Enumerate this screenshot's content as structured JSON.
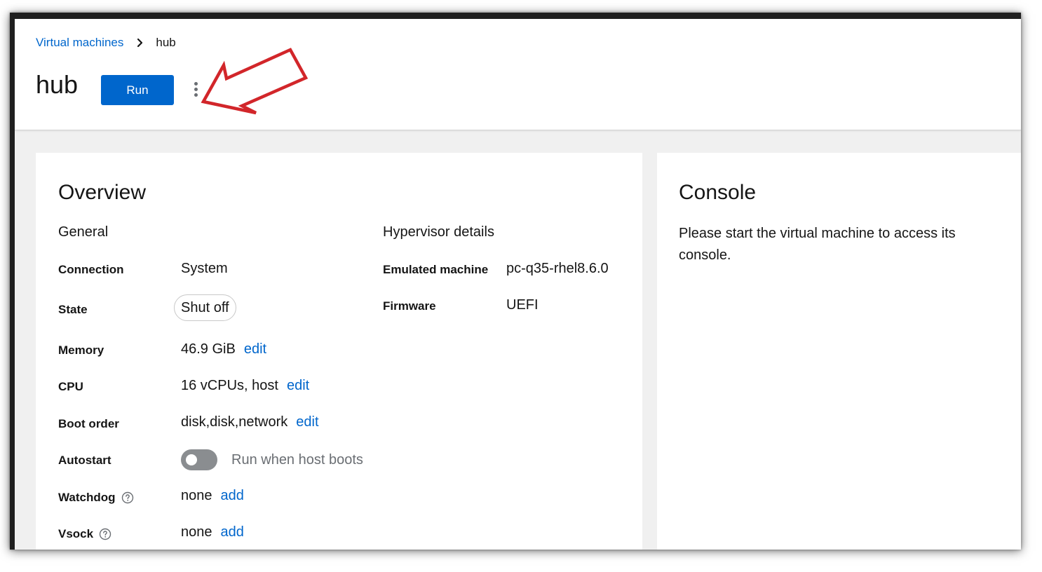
{
  "breadcrumb": {
    "parent": "Virtual machines",
    "current": "hub"
  },
  "header": {
    "title": "hub",
    "run_label": "Run"
  },
  "overview": {
    "title": "Overview",
    "general": {
      "heading": "General",
      "connection_label": "Connection",
      "connection_value": "System",
      "state_label": "State",
      "state_value": "Shut off",
      "memory_label": "Memory",
      "memory_value": "46.9 GiB",
      "memory_action": "edit",
      "cpu_label": "CPU",
      "cpu_value": "16 vCPUs, host",
      "cpu_action": "edit",
      "boot_label": "Boot order",
      "boot_value": "disk,disk,network",
      "boot_action": "edit",
      "autostart_label": "Autostart",
      "autostart_on": false,
      "autostart_text": "Run when host boots",
      "watchdog_label": "Watchdog",
      "watchdog_value": "none",
      "watchdog_action": "add",
      "vsock_label": "Vsock",
      "vsock_value": "none",
      "vsock_action": "add"
    },
    "hypervisor": {
      "heading": "Hypervisor details",
      "emulated_label": "Emulated machine",
      "emulated_value": "pc-q35-rhel8.6.0",
      "firmware_label": "Firmware",
      "firmware_value": "UEFI"
    }
  },
  "console": {
    "title": "Console",
    "message": "Please start the virtual machine to access its console."
  },
  "colors": {
    "accent": "#0066cc",
    "annotation": "#d2262a"
  },
  "icons": {
    "breadcrumb_separator": "chevron-right-icon",
    "menu": "kebab-menu-icon",
    "help": "help-circle-icon",
    "annotation": "arrow-annotation-icon"
  }
}
